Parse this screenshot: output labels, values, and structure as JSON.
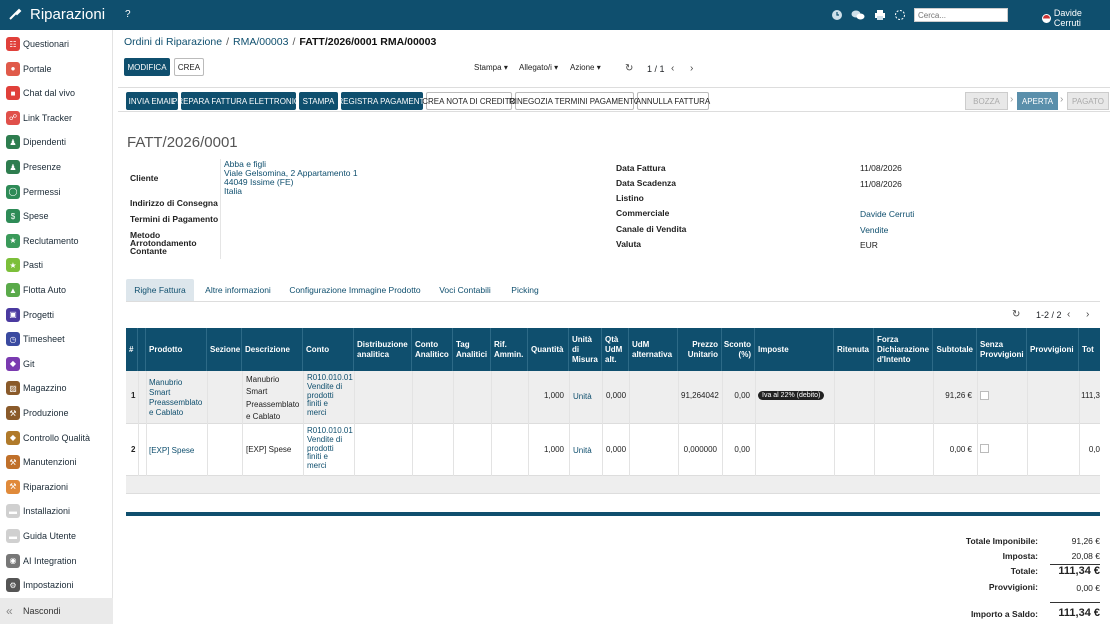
{
  "topbar": {
    "app_title": "Riparazioni",
    "help": "?",
    "search_placeholder": "Cerca...",
    "user_name": "Davide Cerruti"
  },
  "sidebar": {
    "items": [
      {
        "label": "Questionari",
        "color": "#e0403a",
        "icon": "questionnaire-icon"
      },
      {
        "label": "Portale",
        "color": "#e05a4a",
        "icon": "portal-icon"
      },
      {
        "label": "Chat dal vivo",
        "color": "#e0403a",
        "icon": "chat-icon"
      },
      {
        "label": "Link Tracker",
        "color": "#e0504a",
        "icon": "link-icon"
      },
      {
        "label": "Dipendenti",
        "color": "#2e7d4f",
        "icon": "employees-icon"
      },
      {
        "label": "Presenze",
        "color": "#2e7d4f",
        "icon": "attendance-icon"
      },
      {
        "label": "Permessi",
        "color": "#2e8b57",
        "icon": "leave-icon"
      },
      {
        "label": "Spese",
        "color": "#2e8b57",
        "icon": "expenses-icon"
      },
      {
        "label": "Reclutamento",
        "color": "#3a9a5a",
        "icon": "recruitment-icon"
      },
      {
        "label": "Pasti",
        "color": "#7cbf3a",
        "icon": "meals-icon"
      },
      {
        "label": "Flotta Auto",
        "color": "#5aaa4a",
        "icon": "fleet-icon"
      },
      {
        "label": "Progetti",
        "color": "#4a3aa0",
        "icon": "projects-icon"
      },
      {
        "label": "Timesheet",
        "color": "#3a4aa0",
        "icon": "timesheet-icon"
      },
      {
        "label": "Git",
        "color": "#7a3ab0",
        "icon": "git-icon"
      },
      {
        "label": "Magazzino",
        "color": "#8a5a2a",
        "icon": "warehouse-icon"
      },
      {
        "label": "Produzione",
        "color": "#8a5a2a",
        "icon": "manufacturing-icon"
      },
      {
        "label": "Controllo Qualità",
        "color": "#b07a2a",
        "icon": "quality-icon"
      },
      {
        "label": "Manutenzioni",
        "color": "#c0702a",
        "icon": "maintenance-icon"
      },
      {
        "label": "Riparazioni",
        "color": "#e08a3a",
        "icon": "repair-icon"
      },
      {
        "label": "Installazioni",
        "color": "#d0d0d0",
        "icon": "installations-icon"
      },
      {
        "label": "Guida Utente",
        "color": "#d0d0d0",
        "icon": "guide-icon"
      },
      {
        "label": "AI Integration",
        "color": "#777777",
        "icon": "ai-icon"
      },
      {
        "label": "Impostazioni",
        "color": "#555555",
        "icon": "settings-icon"
      }
    ],
    "hide_label": "Nascondi"
  },
  "breadcrumb": {
    "items": [
      "Ordini di Riparazione",
      "RMA/00003"
    ],
    "separator": "/",
    "current": "FATT/2026/0001 RMA/00003"
  },
  "controls": {
    "edit_label": "MODIFICA",
    "create_label": "CREA",
    "print_dd": "Stampa",
    "attach_dd": "Allegato/i",
    "action_dd": "Azione",
    "pager": "1 / 1"
  },
  "header_buttons": {
    "send_email": "INVIA EMAIL",
    "e_invoice": "PREPARA FATTURA ELETTRONICA",
    "print": "STAMPA",
    "register_payment": "REGISTRA PAGAMENTI",
    "credit_note": "CREA NOTA DI CREDITO",
    "renegotiate": "RINEGOZIA TERMINI PAGAMENTO",
    "cancel_invoice": "ANNULLA FATTURA"
  },
  "stages": {
    "draft": "BOZZA",
    "open": "APERTA",
    "paid": "PAGATO"
  },
  "invoice": {
    "name": "FATT/2026/0001",
    "labels": {
      "customer": "Cliente",
      "delivery_address": "Indirizzo di Consegna",
      "payment_terms": "Termini di Pagamento",
      "rounding_1": "Metodo",
      "rounding_2": "Arrotondamento",
      "rounding_3": "Contante",
      "invoice_date": "Data Fattura",
      "due_date": "Data Scadenza",
      "pricelist": "Listino",
      "salesperson": "Commerciale",
      "sales_channel": "Canale di Vendita",
      "currency": "Valuta"
    },
    "customer_lines": [
      "Abba e figli",
      "Viale Gelsomina, 2 Appartamento 1",
      "44049 Issime (FE)",
      "Italia"
    ],
    "invoice_date": "11/08/2026",
    "due_date": "11/08/2026",
    "salesperson": "Davide Cerruti",
    "sales_channel": "Vendite",
    "currency": "EUR"
  },
  "tabs": [
    "Righe Fattura",
    "Altre informazioni",
    "Configurazione Immagine Prodotto",
    "Voci Contabili",
    "Picking"
  ],
  "lines_pager": "1-2 / 2",
  "table": {
    "headers": {
      "num": "#",
      "product": "Prodotto",
      "section": "Sezione",
      "description": "Descrizione",
      "account": "Conto",
      "analytic_dist_1": "Distribuzione",
      "analytic_dist_2": "analitica",
      "analytic_acc_1": "Conto",
      "analytic_acc_2": "Analitico",
      "analytic_tags_1": "Tag",
      "analytic_tags_2": "Analitici",
      "admin_ref_1": "Rif.",
      "admin_ref_2": "Ammin.",
      "qty": "Quantità",
      "uom_1": "Unità",
      "uom_2": "di",
      "uom_3": "Misura",
      "qty_alt_1": "Qtà",
      "qty_alt_2": "UdM",
      "qty_alt_3": "alt.",
      "uom_alt_1": "UdM",
      "uom_alt_2": "alternativa",
      "price_1": "Prezzo",
      "price_2": "Unitario",
      "discount_1": "Sconto",
      "discount_2": "(%)",
      "taxes": "Imposte",
      "withholding": "Ritenuta",
      "intent_1": "Forza",
      "intent_2": "Dichiarazione",
      "intent_3": "d'Intento",
      "subtotal": "Subtotale",
      "no_commission_1": "Senza",
      "no_commission_2": "Provvigioni",
      "commissions": "Provvigioni",
      "total": "Tot"
    },
    "rows": [
      {
        "num": "1",
        "product": [
          "Manubrio",
          "Smart",
          "Preassemblato",
          "e Cablato"
        ],
        "description": [
          "Manubrio",
          "Smart",
          "Preassemblato",
          "e Cablato"
        ],
        "account": [
          "R010.010.01",
          "Vendite di",
          "prodotti",
          "finiti e",
          "merci"
        ],
        "qty": "1,000",
        "uom": "Unità",
        "qty_alt": "0,000",
        "price": "91,264042",
        "discount": "0,00",
        "tax": "Iva al 22% (debito)",
        "subtotal": "91,26 €",
        "total": "111,3"
      },
      {
        "num": "2",
        "product": [
          "[EXP] Spese"
        ],
        "description": [
          "[EXP] Spese"
        ],
        "account": [
          "R010.010.01",
          "Vendite di",
          "prodotti",
          "finiti e",
          "merci"
        ],
        "qty": "1,000",
        "uom": "Unità",
        "qty_alt": "0,000",
        "price": "0,000000",
        "discount": "0,00",
        "tax": "",
        "subtotal": "0,00 €",
        "total": "0,0"
      }
    ]
  },
  "totals": {
    "untaxed_label": "Totale Imponibile:",
    "untaxed": "91,26 €",
    "tax_label": "Imposta:",
    "tax": "20,08 €",
    "total_label": "Totale:",
    "total": "111,34 €",
    "commissions_label": "Provvigioni:",
    "commissions": "0,00 €",
    "residual_label": "Importo a Saldo:",
    "residual": "111,34 €"
  }
}
